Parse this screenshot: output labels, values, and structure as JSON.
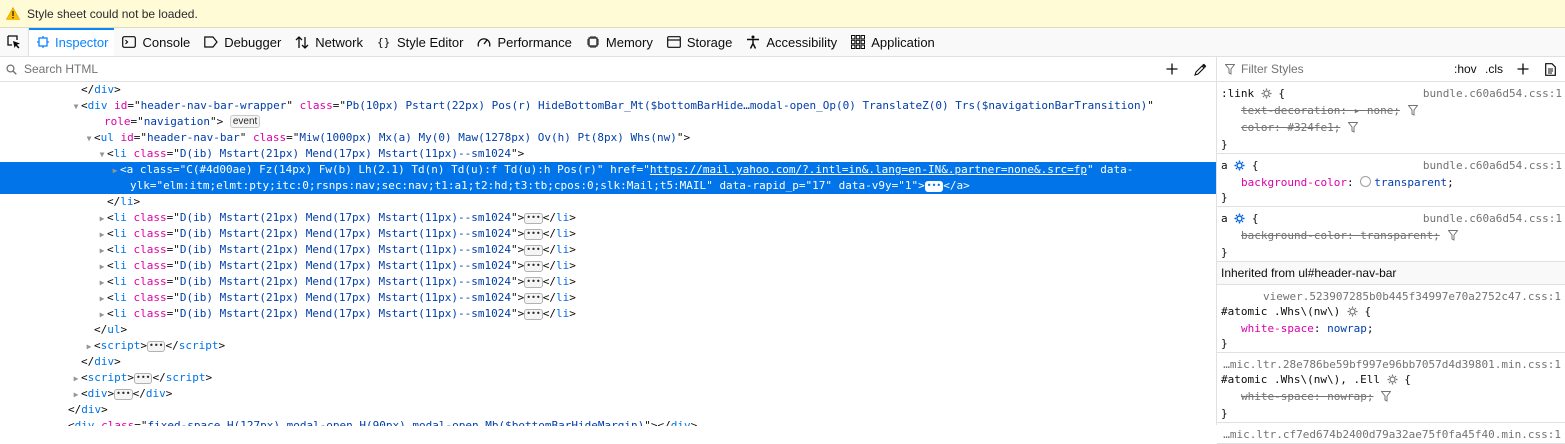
{
  "warning": {
    "text": "Style sheet could not be loaded."
  },
  "tabs": [
    {
      "label": "Inspector",
      "icon": "inspector-icon",
      "selected": true
    },
    {
      "label": "Console",
      "icon": "console-icon"
    },
    {
      "label": "Debugger",
      "icon": "debugger-icon"
    },
    {
      "label": "Network",
      "icon": "network-icon"
    },
    {
      "label": "Style Editor",
      "icon": "style-editor-icon"
    },
    {
      "label": "Performance",
      "icon": "performance-icon"
    },
    {
      "label": "Memory",
      "icon": "memory-icon"
    },
    {
      "label": "Storage",
      "icon": "storage-icon"
    },
    {
      "label": "Accessibility",
      "icon": "accessibility-icon"
    },
    {
      "label": "Application",
      "icon": "application-icon"
    }
  ],
  "markup": {
    "search_placeholder": "Search HTML",
    "lines": [
      {
        "t": "close",
        "tag": "div"
      },
      {
        "t": "open",
        "tag": "div",
        "twisty": "open",
        "attrs": [
          [
            "id",
            "header-nav-bar-wrapper"
          ],
          [
            "class",
            "Pb(10px) Pstart(22px) Pos(r) HideBottomBar_Mt($bottomBarHide…modal-open_Op(0) TranslateZ(0) Trs($navigationBarTransition)"
          ]
        ]
      },
      {
        "t": "cont",
        "attrs": [
          [
            "role",
            "navigation"
          ]
        ],
        "badge": "event",
        "end": ">"
      },
      {
        "t": "open",
        "tag": "ul",
        "twisty": "open",
        "attrs": [
          [
            "id",
            "header-nav-bar"
          ],
          [
            "class",
            "Miw(1000px) Mx(a) My(0) Maw(1278px) Ov(h) Pt(8px) Whs(nw)"
          ]
        ],
        "end": ">"
      },
      {
        "t": "open",
        "tag": "li",
        "twisty": "open",
        "attrs": [
          [
            "class",
            "D(ib) Mstart(21px) Mend(17px) Mstart(11px)--sm1024"
          ]
        ],
        "end": ">"
      },
      {
        "t": "sel1",
        "tag": "a",
        "twisty": "closed",
        "attrs": [
          [
            "class",
            "C(#4d00ae) Fz(14px) Fw(b) Lh(2.1) Td(n) Td(u):f Td(u):h Pos(r)"
          ]
        ],
        "href": "https://mail.yahoo.com/?.intl=in&.lang=en-IN&.partner=none&.src=fp",
        "tail": " data-"
      },
      {
        "t": "sel2",
        "attrs": [
          [
            "ylk",
            "elm:itm;elmt:pty;itc:0;rsnps:nav;sec:nav;t1:a1;t2:hd;t3:tb;cpos:0;slk:Mail;t5:MAIL"
          ],
          [
            "data-rapid_p",
            "17"
          ],
          [
            "data-v9y",
            "1"
          ]
        ],
        "closetag": "a"
      },
      {
        "t": "close",
        "tag": "li"
      },
      {
        "t": "coll",
        "tag": "li",
        "attrs": [
          [
            "class",
            "D(ib) Mstart(21px) Mend(17px) Mstart(11px)--sm1024"
          ]
        ]
      },
      {
        "t": "coll",
        "tag": "li",
        "attrs": [
          [
            "class",
            "D(ib) Mstart(21px) Mend(17px) Mstart(11px)--sm1024"
          ]
        ]
      },
      {
        "t": "coll",
        "tag": "li",
        "attrs": [
          [
            "class",
            "D(ib) Mstart(21px) Mend(17px) Mstart(11px)--sm1024"
          ]
        ]
      },
      {
        "t": "coll",
        "tag": "li",
        "attrs": [
          [
            "class",
            "D(ib) Mstart(21px) Mend(17px) Mstart(11px)--sm1024"
          ]
        ]
      },
      {
        "t": "coll",
        "tag": "li",
        "attrs": [
          [
            "class",
            "D(ib) Mstart(21px) Mend(17px) Mstart(11px)--sm1024"
          ]
        ]
      },
      {
        "t": "coll",
        "tag": "li",
        "attrs": [
          [
            "class",
            "D(ib) Mstart(21px) Mend(17px) Mstart(11px)--sm1024"
          ]
        ]
      },
      {
        "t": "coll",
        "tag": "li",
        "attrs": [
          [
            "class",
            "D(ib) Mstart(21px) Mend(17px) Mstart(11px)--sm1024"
          ]
        ]
      },
      {
        "t": "close",
        "tag": "ul"
      },
      {
        "t": "coll",
        "tag": "script",
        "attrs": []
      },
      {
        "t": "close",
        "tag": "div"
      },
      {
        "t": "coll",
        "tag": "script",
        "attrs": []
      },
      {
        "t": "coll",
        "tag": "div",
        "attrs": []
      },
      {
        "t": "close",
        "tag": "div"
      },
      {
        "t": "empty",
        "tag": "div",
        "attrs": [
          [
            "class",
            "fixed-space H(127px) modal-open_H(90px) modal-open_Mb($bottomBarHideMargin)"
          ]
        ]
      }
    ]
  },
  "rules": {
    "filter_placeholder": "Filter Styles",
    "hov": ":hov",
    "cls": ".cls",
    "blocks": [
      {
        "selector": ":link",
        "source": "bundle.c60a6d54.css:1",
        "decls": [
          {
            "name": "text-decoration",
            "value": "none",
            "struck": true,
            "arrow": true
          },
          {
            "name": "color",
            "value": "#324fe1",
            "struck": true
          }
        ]
      },
      {
        "selector": "a",
        "source": "bundle.c60a6d54.css:1",
        "decls": [
          {
            "name": "background-color",
            "value": "transparent",
            "swatch": true
          }
        ]
      },
      {
        "selector": "a",
        "source": "bundle.c60a6d54.css:1",
        "decls": [
          {
            "name": "background-color",
            "value": "transparent",
            "struck": true
          }
        ]
      }
    ],
    "inherited_header": "Inherited from ul#header-nav-bar",
    "inherited_blocks": [
      {
        "source": "viewer.523907285b0b445f34997e70a2752c47.css:1",
        "selector": "#atomic .Whs\\(nw\\)",
        "decls": [
          {
            "name": "white-space",
            "value": "nowrap"
          }
        ]
      },
      {
        "source": "…mic.ltr.28e786be59bf997e96bb7057d4d39801.min.css:1",
        "selector": "#atomic .Whs\\(nw\\), .Ell",
        "decls": [
          {
            "name": "white-space",
            "value": "nowrap",
            "struck": true
          }
        ]
      },
      {
        "source": "…mic.ltr.cf7ed674b2400d79a32ae75f0fa45f40.min.css:1"
      }
    ]
  }
}
